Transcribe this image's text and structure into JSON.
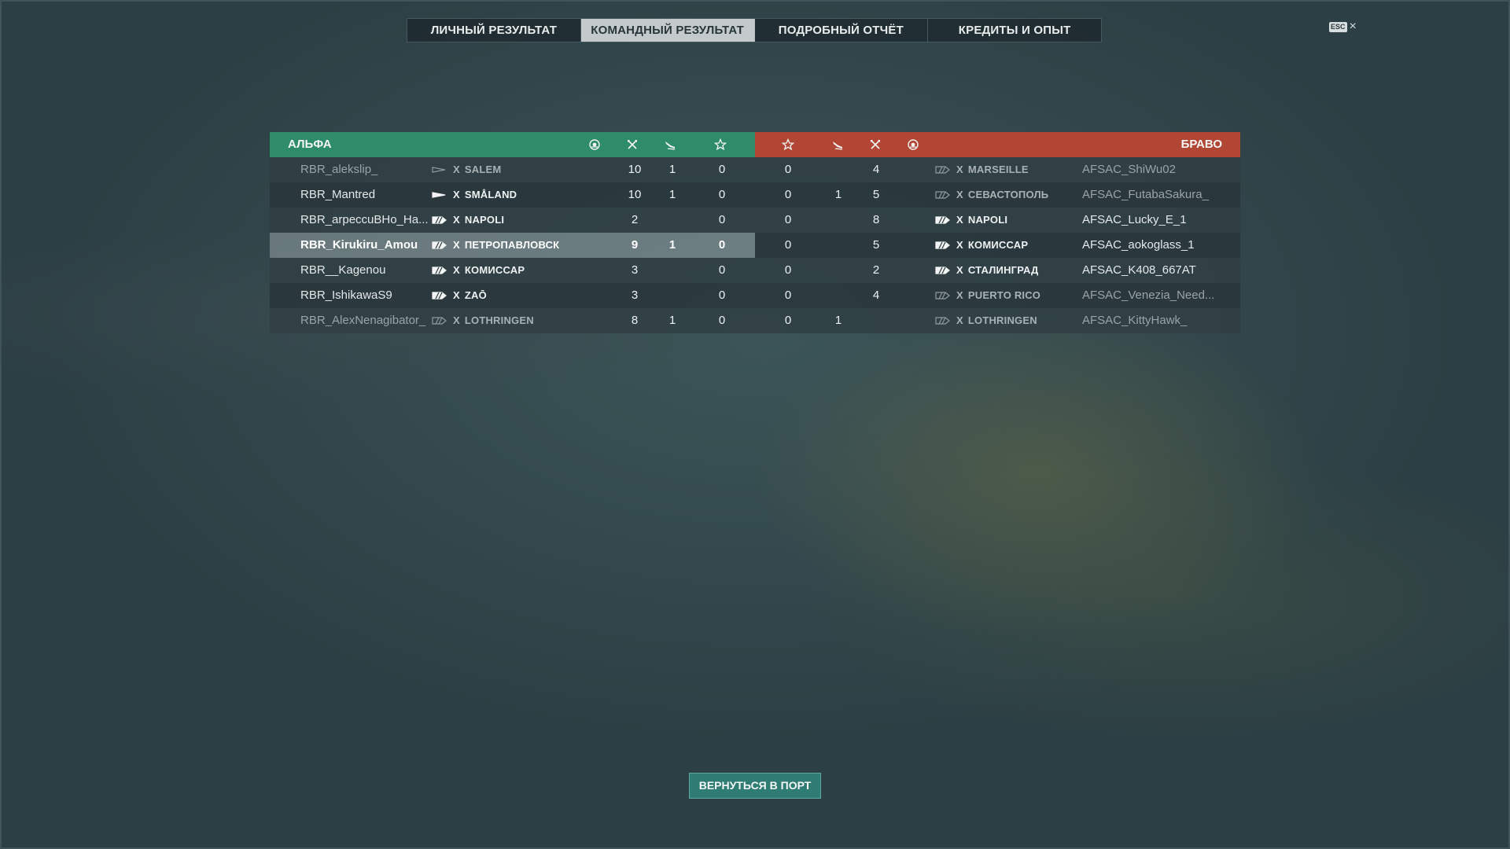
{
  "tabs": [
    {
      "label": "ЛИЧНЫЙ РЕЗУЛЬТАТ",
      "active": false
    },
    {
      "label": "КОМАНДНЫЙ РЕЗУЛЬТАТ",
      "active": true
    },
    {
      "label": "ПОДРОБНЫЙ ОТЧЁТ",
      "active": false
    },
    {
      "label": "КРЕДИТЫ И ОПЫТ",
      "active": false
    }
  ],
  "close": {
    "badge": "ESC",
    "icon": "×"
  },
  "teams": {
    "left": {
      "name": "АЛЬФА",
      "color": "#2f8c6a"
    },
    "right": {
      "name": "БРАВО",
      "color": "#b24634"
    }
  },
  "column_icons": [
    "base-capture-icon",
    "ships-destroyed-icon",
    "planes-destroyed-icon",
    "experience-star-icon"
  ],
  "left_rows": [
    {
      "player": "RBR_alekslip_",
      "class": "destroyer",
      "status": "sunk",
      "tier": "X",
      "ship": "SALEM",
      "frags": "10",
      "planes": "1",
      "xp": "0"
    },
    {
      "player": "RBR_Mantred",
      "class": "destroyer",
      "status": "alive",
      "tier": "X",
      "ship": "SMÅLAND",
      "frags": "10",
      "planes": "1",
      "xp": "0"
    },
    {
      "player": "RBR_arpeccuBHo_Ha...",
      "class": "cruiser",
      "status": "alive",
      "tier": "X",
      "ship": "NAPOLI",
      "frags": "2",
      "planes": "",
      "xp": "0"
    },
    {
      "player": "RBR_Kirukiru_Amou",
      "class": "cruiser",
      "status": "self",
      "tier": "X",
      "ship": "ПЕТРОПАВЛОВСК",
      "frags": "9",
      "planes": "1",
      "xp": "0"
    },
    {
      "player": "RBR__Kagenou",
      "class": "cruiser",
      "status": "alive",
      "tier": "X",
      "ship": "КОМИССАР",
      "frags": "3",
      "planes": "",
      "xp": "0"
    },
    {
      "player": "RBR_IshikawaS9",
      "class": "cruiser",
      "status": "alive",
      "tier": "X",
      "ship": "ZAŌ",
      "frags": "3",
      "planes": "",
      "xp": "0"
    },
    {
      "player": "RBR_AlexNenagibator_",
      "class": "cruiser",
      "status": "sunk",
      "tier": "X",
      "ship": "LOTHRINGEN",
      "frags": "8",
      "planes": "1",
      "xp": "0"
    }
  ],
  "right_rows": [
    {
      "player": "AFSAC_ShiWu02",
      "class": "cruiser",
      "status": "sunk",
      "tier": "X",
      "ship": "MARSEILLE",
      "frags": "4",
      "planes": "",
      "xp": "0"
    },
    {
      "player": "AFSAC_FutabaSakura_",
      "class": "cruiser",
      "status": "sunk",
      "tier": "X",
      "ship": "СЕВАСТОПОЛЬ",
      "frags": "5",
      "planes": "1",
      "xp": "0"
    },
    {
      "player": "AFSAC_Lucky_E_1",
      "class": "cruiser",
      "status": "alive",
      "tier": "X",
      "ship": "NAPOLI",
      "frags": "8",
      "planes": "",
      "xp": "0"
    },
    {
      "player": "AFSAC_aokoglass_1",
      "class": "cruiser",
      "status": "alive",
      "tier": "X",
      "ship": "КОМИССАР",
      "frags": "5",
      "planes": "",
      "xp": "0"
    },
    {
      "player": "AFSAC_K408_667AT",
      "class": "cruiser",
      "status": "alive",
      "tier": "X",
      "ship": "СТАЛИНГРАД",
      "frags": "2",
      "planes": "",
      "xp": "0"
    },
    {
      "player": "AFSAC_Venezia_Need...",
      "class": "cruiser",
      "status": "sunk",
      "tier": "X",
      "ship": "PUERTO RICO",
      "frags": "4",
      "planes": "",
      "xp": "0"
    },
    {
      "player": "AFSAC_KittyHawk_",
      "class": "cruiser",
      "status": "sunk",
      "tier": "X",
      "ship": "LOTHRINGEN",
      "frags": "",
      "planes": "1",
      "xp": "0"
    }
  ],
  "footer": {
    "return_label": "ВЕРНУТЬСЯ В ПОРТ"
  }
}
